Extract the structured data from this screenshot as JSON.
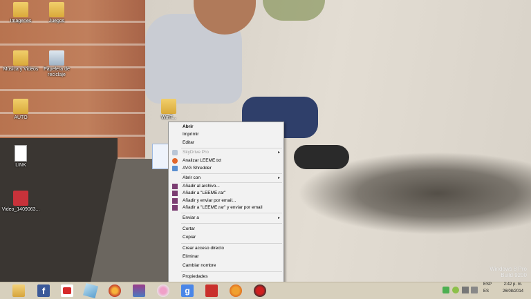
{
  "desktop": {
    "icons": [
      {
        "label": "Imagenes"
      },
      {
        "label": "Juegos"
      },
      {
        "label": "Musica y Videos"
      },
      {
        "label": "Papelera de reciclaje"
      },
      {
        "label": "AUTO"
      },
      {
        "label": "WinT..."
      },
      {
        "label": "LINK"
      },
      {
        "label": "Video_1409063..."
      }
    ]
  },
  "context_menu": {
    "items": [
      {
        "label": "Abrir"
      },
      {
        "label": "Imprimir"
      },
      {
        "label": "Editar"
      },
      {
        "label": "SkyDrive Pro"
      },
      {
        "label": "Analizar LEEME.txt"
      },
      {
        "label": "AVG Shredder"
      },
      {
        "label": "Abrir con"
      },
      {
        "label": "Añadir al archivo..."
      },
      {
        "label": "Añadir a \"LEEME.rar\""
      },
      {
        "label": "Añadir y enviar por email..."
      },
      {
        "label": "Añadir a \"LEEME.rar\" y enviar por email"
      },
      {
        "label": "Enviar a"
      },
      {
        "label": "Cortar"
      },
      {
        "label": "Copiar"
      },
      {
        "label": "Crear acceso directo"
      },
      {
        "label": "Eliminar"
      },
      {
        "label": "Cambiar nombre"
      },
      {
        "label": "Propiedades"
      }
    ]
  },
  "watermark": {
    "line1": "Windows 8 Pro",
    "line2": "Build 9200"
  },
  "tray": {
    "lang_top": "ESP",
    "lang_bottom": "ES",
    "time": "2:42 p. m.",
    "date": "26/08/2014"
  },
  "taskbar": {
    "apps": [
      "file-explorer-icon",
      "facebook-icon",
      "youtube-icon",
      "app-icon",
      "chrome-like-icon",
      "winrar-icon",
      "flower-icon",
      "google-icon",
      "pdf-icon",
      "java-icon",
      "game-icon"
    ]
  },
  "colors": {
    "menu_bg": "#f2f2f2",
    "taskbar_bg": "#d7d0bd",
    "accent": "#3a78c8"
  }
}
